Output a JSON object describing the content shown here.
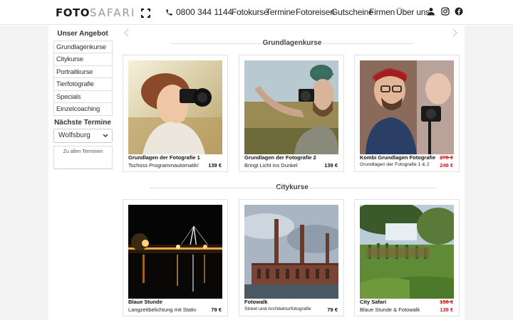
{
  "header": {
    "logo_bold": "FOTO",
    "logo_light": "SAFARI",
    "phone": "0800 344 1144",
    "nav": [
      "Fotokurse",
      "Termine",
      "Fotoreisen",
      "Gutscheine",
      "Firmen",
      "Über uns"
    ],
    "icons": [
      "user-icon",
      "instagram-icon",
      "facebook-icon"
    ]
  },
  "sidebar": {
    "title": "Unser Angebot",
    "items": [
      "Grundlagenkurse",
      "Citykurse",
      "Portraitkurse",
      "Tierfotografie",
      "Specials",
      "Einzelcoaching"
    ],
    "dates_title": "Nächste Termine",
    "city_select": "Wolfsburg",
    "all_dates_button": "Zu allen Terminen"
  },
  "sections": [
    {
      "heading": "Grundlagenkurse",
      "cards": [
        {
          "title": "Grundlagen der Fotografie 1",
          "subtitle": "Tschüss Programmautomatik!",
          "price": "139 €"
        },
        {
          "title": "Grundlagen der Fotografie 2",
          "subtitle": "Bringt Licht ins Dunkel",
          "price": "139 €"
        },
        {
          "title": "Kombi Grundlagen Fotografie",
          "subtitle": "Grundlagen der Fotografie 1 & 2",
          "old_price": "278 €",
          "price": "249 €"
        }
      ]
    },
    {
      "heading": "Citykurse",
      "cards": [
        {
          "title": "Blaue Stunde",
          "subtitle": "Langzeitbelichtung mit Stativ",
          "price": "79 €"
        },
        {
          "title": "Fotowalk",
          "subtitle": "Street und Architekturfotografie",
          "price": "79 €"
        },
        {
          "title": "City Safari",
          "subtitle": "Blaue Stunde & Fotowalk",
          "old_price": "158 €",
          "price": "139 €"
        }
      ]
    }
  ],
  "colors": {
    "accent_red": "#cc2222",
    "page_bg": "#f3f3f3"
  }
}
